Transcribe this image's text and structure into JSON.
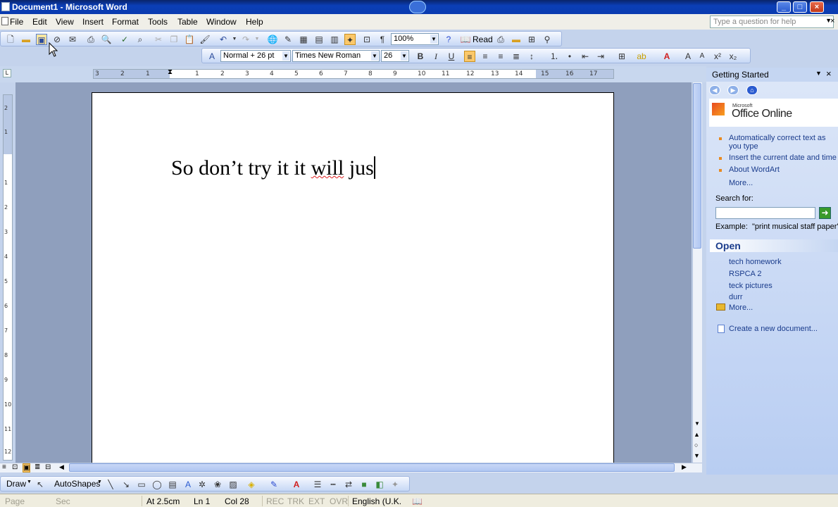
{
  "window": {
    "title": "Document1 - Microsoft Word"
  },
  "menu": {
    "items": [
      "File",
      "Edit",
      "View",
      "Insert",
      "Format",
      "Tools",
      "Table",
      "Window",
      "Help"
    ]
  },
  "ask": {
    "placeholder": "Type a question for help"
  },
  "standard_toolbar": {
    "zoom": "100%",
    "read_label": "Read"
  },
  "formatting_toolbar": {
    "style": "Normal + 26 pt",
    "font": "Times New Roman",
    "size": "26"
  },
  "ruler": {
    "ticks": [
      "3",
      "2",
      "1",
      "1",
      "2",
      "3",
      "4",
      "5",
      "6",
      "7",
      "8",
      "9",
      "10",
      "11",
      "12",
      "13",
      "14",
      "15",
      "16",
      "17"
    ],
    "vticks": [
      "2",
      "1",
      "1",
      "2",
      "3",
      "4",
      "5",
      "6",
      "7",
      "8",
      "9",
      "10",
      "11",
      "12"
    ]
  },
  "document": {
    "text_before": "So don’t try it it ",
    "text_misspelled": "will",
    "text_after": " jus"
  },
  "task_pane": {
    "title": "Getting Started",
    "logo_small": "Microsoft",
    "logo": "Office Online",
    "links": [
      "Automatically correct text as you type",
      "Insert the current date and time",
      "About WordArt"
    ],
    "more": "More...",
    "search_label": "Search for:",
    "example": "Example:  \"print musical staff paper\"",
    "open_title": "Open",
    "recent_files": [
      "tech homework",
      "RSPCA 2",
      "teck pictures",
      "durr"
    ],
    "open_more": "More...",
    "create_new": "Create a new document..."
  },
  "drawing_toolbar": {
    "draw": "Draw",
    "autoshapes": "AutoShapes"
  },
  "status": {
    "page": "Page",
    "sec": "Sec",
    "at": "At 2.5cm",
    "ln": "Ln 1",
    "col": "Col 28",
    "rec": "REC",
    "trk": "TRK",
    "ext": "EXT",
    "ovr": "OVR",
    "lang": "English (U.K."
  }
}
